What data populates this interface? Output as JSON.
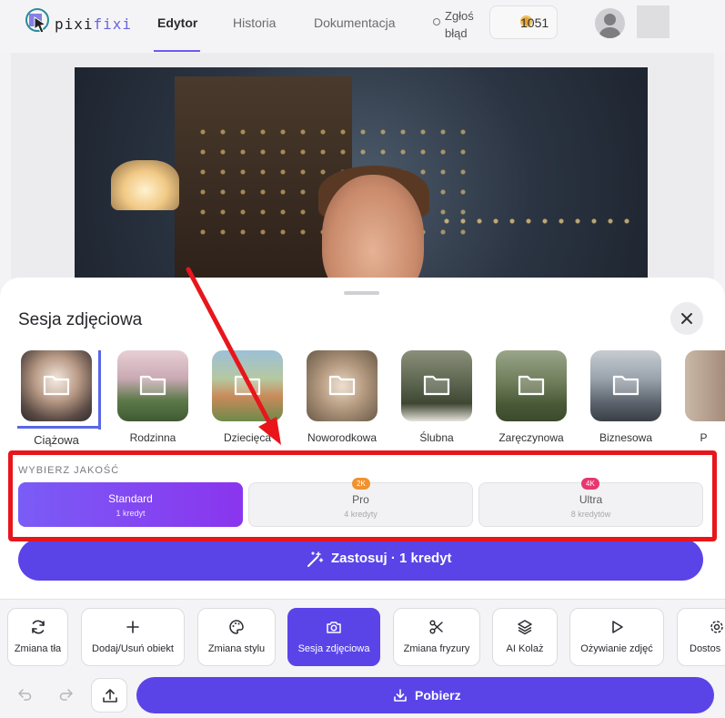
{
  "header": {
    "logo_a": "pixi",
    "logo_b": "fixi",
    "tabs": [
      {
        "label": "Edytor",
        "active": true
      },
      {
        "label": "Historia",
        "active": false
      },
      {
        "label": "Dokumentacja",
        "active": false
      }
    ],
    "report_line1": "Zgłoś",
    "report_line2": "błąd",
    "credits": "1051",
    "icons": {
      "report": "circle-icon",
      "credits": "coin-icon",
      "avatar": "user-avatar-icon"
    }
  },
  "sheet": {
    "title": "Sesja zdjęciowa",
    "close_icon": "close-icon",
    "categories": [
      {
        "label": "Ciążowa",
        "selected": true
      },
      {
        "label": "Rodzinna",
        "selected": false
      },
      {
        "label": "Dziecięca",
        "selected": false
      },
      {
        "label": "Noworodkowa",
        "selected": false
      },
      {
        "label": "Ślubna",
        "selected": false
      },
      {
        "label": "Zaręczynowa",
        "selected": false
      },
      {
        "label": "Biznesowa",
        "selected": false
      },
      {
        "label": "P",
        "selected": false
      }
    ],
    "quality_label": "WYBIERZ JAKOŚĆ",
    "quality": [
      {
        "name": "Standard",
        "sub": "1 kredyt",
        "badge": "",
        "active": true
      },
      {
        "name": "Pro",
        "sub": "4 kredyty",
        "badge": "2K",
        "active": false
      },
      {
        "name": "Ultra",
        "sub": "8 kredytów",
        "badge": "4K",
        "active": false
      }
    ],
    "apply_label": "Zastosuj · 1 kredyt",
    "apply_icon": "magic-wand-icon"
  },
  "toolbar": {
    "tools": [
      {
        "label": "Zmiana tła",
        "icon": "refresh-icon",
        "active": false
      },
      {
        "label": "Dodaj/Usuń obiekt",
        "icon": "plus-icon",
        "active": false
      },
      {
        "label": "Zmiana stylu",
        "icon": "palette-icon",
        "active": false
      },
      {
        "label": "Sesja zdjęciowa",
        "icon": "camera-icon",
        "active": true
      },
      {
        "label": "Zmiana fryzury",
        "icon": "scissors-icon",
        "active": false
      },
      {
        "label": "AI Kolaż",
        "icon": "layers-icon",
        "active": false
      },
      {
        "label": "Ożywianie zdjęć",
        "icon": "play-icon",
        "active": false
      },
      {
        "label": "Dostos",
        "icon": "gear-icon",
        "active": false
      }
    ],
    "download_label": "Pobierz",
    "icons": {
      "undo": "undo-icon",
      "redo": "redo-icon",
      "upload": "upload-icon",
      "download": "download-icon"
    }
  },
  "colors": {
    "accent": "#5a44e8",
    "highlight_box": "#e8161b",
    "badge_2k": "#f0922e",
    "badge_4k": "#e8366f"
  }
}
